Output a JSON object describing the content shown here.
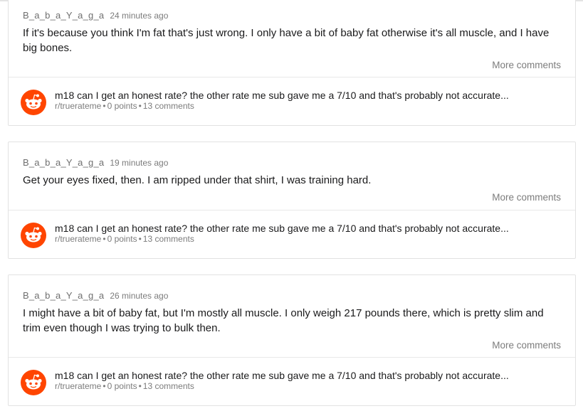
{
  "comments": [
    {
      "author": "B_a_b_a_Y_a_g_a",
      "time": "24 minutes ago",
      "body": "If it's because you think I'm fat that's just wrong. I only have a bit of baby fat otherwise it's all muscle, and I have big bones.",
      "more": "More comments",
      "post": {
        "title": "m18 can I get an honest rate? the other rate me sub gave me a 7/10 and that's probably not accurate...",
        "subreddit": "r/truerateme",
        "points": "0 points",
        "comments": "13 comments"
      }
    },
    {
      "author": "B_a_b_a_Y_a_g_a",
      "time": "19 minutes ago",
      "body": "Get your eyes fixed, then. I am ripped under that shirt, I was training hard.",
      "more": "More comments",
      "post": {
        "title": "m18 can I get an honest rate? the other rate me sub gave me a 7/10 and that's probably not accurate...",
        "subreddit": "r/truerateme",
        "points": "0 points",
        "comments": "13 comments"
      }
    },
    {
      "author": "B_a_b_a_Y_a_g_a",
      "time": "26 minutes ago",
      "body": "I might have a bit of baby fat, but I'm mostly all muscle. I only weigh 217 pounds there, which is pretty slim and trim even though I was trying to bulk then.",
      "more": "More comments",
      "post": {
        "title": "m18 can I get an honest rate? the other rate me sub gave me a 7/10 and that's probably not accurate...",
        "subreddit": "r/truerateme",
        "points": "0 points",
        "comments": "13 comments"
      }
    }
  ],
  "colors": {
    "reddit_orange": "#ff4500",
    "muted_text": "#7c7c7c",
    "border": "#e2e2e2"
  },
  "icons": {
    "subreddit_avatar": "reddit-snoo-icon"
  }
}
